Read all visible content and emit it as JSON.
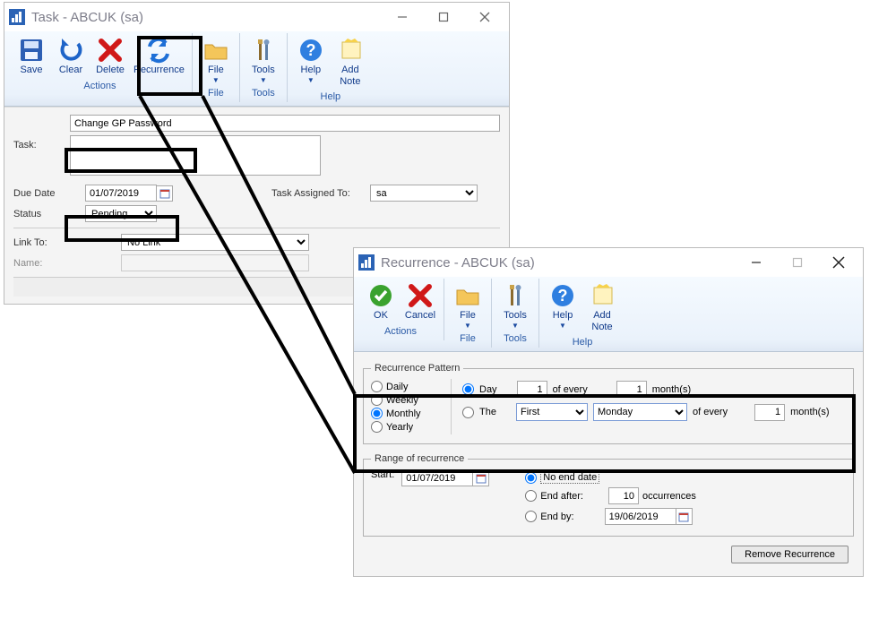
{
  "task_window": {
    "title": "Task  -  ABCUK (sa)",
    "ribbon": {
      "groups": [
        {
          "label": "Actions",
          "buttons": [
            {
              "name": "save-button",
              "label": "Save"
            },
            {
              "name": "clear-button",
              "label": "Clear"
            },
            {
              "name": "delete-button",
              "label": "Delete"
            },
            {
              "name": "recurrence-button",
              "label": "Recurrence"
            }
          ]
        },
        {
          "label": "File",
          "buttons": [
            {
              "name": "file-button",
              "label": "File",
              "dropdown": true
            }
          ]
        },
        {
          "label": "Tools",
          "buttons": [
            {
              "name": "tools-button",
              "label": "Tools",
              "dropdown": true
            }
          ]
        },
        {
          "label": "Help",
          "buttons": [
            {
              "name": "help-button",
              "label": "Help",
              "dropdown": true
            },
            {
              "name": "add-note-button",
              "label": "Add\nNote"
            }
          ]
        }
      ]
    },
    "fields": {
      "task_label": "Task:",
      "task_value": "Change GP Password",
      "due_date_label": "Due Date",
      "due_date_value": "01/07/2019",
      "assigned_label": "Task Assigned To:",
      "assigned_value": "sa",
      "status_label": "Status",
      "status_value": "Pending",
      "link_to_label": "Link To:",
      "link_to_value": "No Link",
      "name_label": "Name:",
      "name_value": ""
    }
  },
  "rec_window": {
    "title": "Recurrence  -  ABCUK (sa)",
    "ribbon": {
      "groups": [
        {
          "label": "Actions",
          "buttons": [
            {
              "name": "ok-button",
              "label": "OK"
            },
            {
              "name": "cancel-button",
              "label": "Cancel"
            }
          ]
        },
        {
          "label": "File",
          "buttons": [
            {
              "name": "file-button",
              "label": "File",
              "dropdown": true
            }
          ]
        },
        {
          "label": "Tools",
          "buttons": [
            {
              "name": "tools-button",
              "label": "Tools",
              "dropdown": true
            }
          ]
        },
        {
          "label": "Help",
          "buttons": [
            {
              "name": "help-button",
              "label": "Help",
              "dropdown": true
            },
            {
              "name": "add-note-button",
              "label": "Add\nNote"
            }
          ]
        }
      ]
    },
    "pattern": {
      "legend": "Recurrence Pattern",
      "daily": "Daily",
      "weekly": "Weekly",
      "monthly": "Monthly",
      "yearly": "Yearly",
      "day_label": "Day",
      "day_num": "1",
      "of_every": "of every",
      "every_months": "1",
      "months_suffix": "month(s)",
      "the_label": "The",
      "ordinal_value": "First",
      "weekday_value": "Monday",
      "of_every2": "of every",
      "every_months2": "1",
      "months_suffix2": "month(s)"
    },
    "range": {
      "legend": "Range of recurrence",
      "start_label": "Start:",
      "start_value": "01/07/2019",
      "no_end": "No end date",
      "end_after": "End after:",
      "occurrences_num": "10",
      "occurrences_suffix": "occurrences",
      "end_by": "End by:",
      "end_by_value": "19/06/2019"
    },
    "remove_button": "Remove Recurrence"
  }
}
